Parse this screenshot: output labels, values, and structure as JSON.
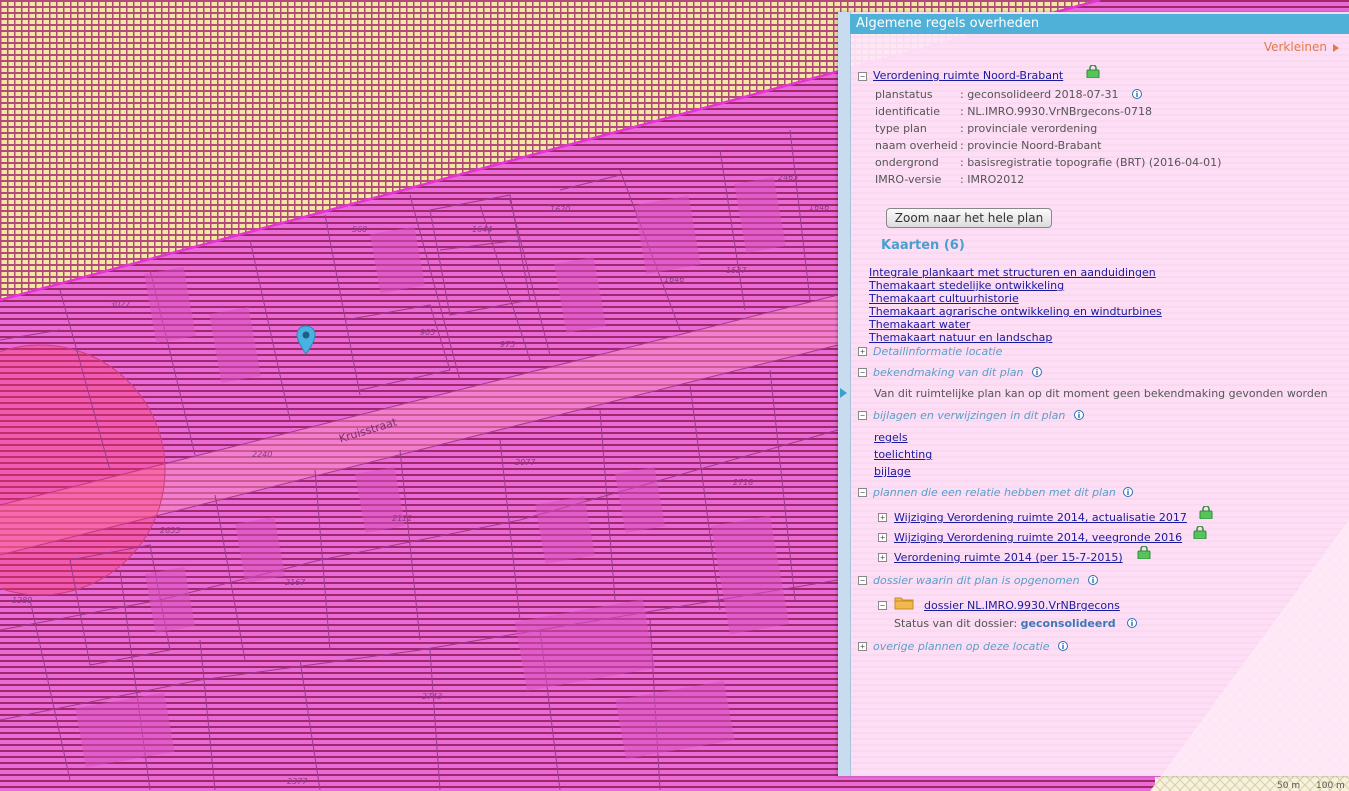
{
  "panel": {
    "title": "Algemene regels overheden",
    "collapse_label": "Verkleinen",
    "plan": {
      "name": "Verordening ruimte Noord-Brabant",
      "fields": [
        {
          "label": "planstatus",
          "value": ": geconsolideerd 2018-07-31"
        },
        {
          "label": "identificatie",
          "value": ": NL.IMRO.9930.VrNBrgecons-0718"
        },
        {
          "label": "type plan",
          "value": ": provinciale verordening"
        },
        {
          "label": "naam overheid",
          "value": ": provincie Noord-Brabant"
        },
        {
          "label": "ondergrond",
          "value": ": basisregistratie topografie (BRT) (2016-04-01)"
        },
        {
          "label": "IMRO-versie",
          "value": ": IMRO2012"
        }
      ],
      "zoom_button": "Zoom naar het hele plan"
    },
    "kaarten": {
      "title": "Kaarten (6)",
      "items": [
        "Integrale plankaart met structuren en aanduidingen",
        "Themakaart stedelijke ontwikkeling",
        "Themakaart cultuurhistorie",
        "Themakaart agrarische ontwikkeling en windturbines",
        "Themakaart water",
        "Themakaart natuur en landschap"
      ]
    },
    "sections": {
      "detail": "Detailinformatie locatie",
      "bekendmaking": "bekendmaking van dit plan",
      "bekendmaking_text": "Van dit ruimtelijke plan kan op dit moment geen bekendmaking gevonden worden",
      "bijlagen": "bijlagen en verwijzingen in dit plan",
      "bijlagen_items": [
        "regels",
        "toelichting",
        "bijlage"
      ],
      "relaties": "plannen die een relatie hebben met dit plan",
      "relaties_items": [
        "Wijziging Verordening ruimte 2014, actualisatie 2017",
        "Wijziging Verordening ruimte 2014, veegronde 2016",
        "Verordening ruimte 2014 (per 15-7-2015)"
      ],
      "dossier": "dossier waarin dit plan is opgenomen",
      "dossier_link": "dossier NL.IMRO.9930.VrNBrgecons",
      "dossier_status_label": "Status van dit dossier:",
      "dossier_status_value": "geconsolideerd",
      "overige": "overige plannen op deze locatie"
    }
  },
  "map": {
    "street": "Kruisstraat",
    "parcel_labels": [
      "3027",
      "560",
      "1644",
      "1620",
      "1646",
      "1537",
      "2463",
      "1646",
      "905",
      "975",
      "2240",
      "2077",
      "2718",
      "2112",
      "2655",
      "2167",
      "1289",
      "2743",
      "2377"
    ],
    "bottom_labels": [
      "50 m",
      "100 m"
    ]
  },
  "colors": {
    "header": "#4fb0d8",
    "map_pink": "#e85fd6",
    "map_yellow": "#f3e7a1",
    "link": "#1a1a9e",
    "section": "#5a9fc8",
    "collapse": "#e07a4a"
  }
}
